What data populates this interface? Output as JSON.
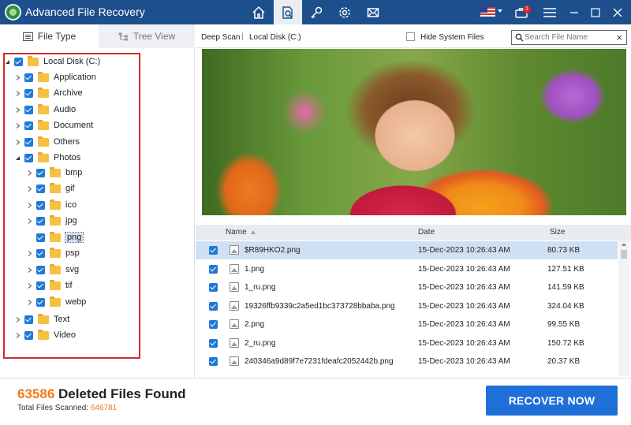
{
  "app": {
    "title": "Advanced File Recovery",
    "notification_count": "1"
  },
  "nav": [
    {
      "name": "home-icon"
    },
    {
      "name": "scan-icon",
      "active": true
    },
    {
      "name": "key-icon"
    },
    {
      "name": "gear-icon"
    },
    {
      "name": "mail-icon"
    }
  ],
  "left": {
    "tabs": {
      "file_type": "File Type",
      "tree_view": "Tree View"
    },
    "tree": {
      "root": "Local Disk (C:)",
      "items": [
        "Application",
        "Archive",
        "Audio",
        "Document",
        "Others",
        "Photos",
        "Text",
        "Video"
      ],
      "photos": [
        "bmp",
        "gif",
        "ico",
        "jpg",
        "png",
        "psp",
        "svg",
        "tif",
        "webp"
      ],
      "selected": "png"
    }
  },
  "topbar": {
    "scan_type": "Deep Scan",
    "separator": "|",
    "location": "Local Disk (C:)",
    "hide_system_files": "Hide System Files",
    "search_placeholder": "Search File Name"
  },
  "list": {
    "headers": {
      "name": "Name",
      "date": "Date",
      "size": "Size"
    },
    "rows": [
      {
        "name": "$R89HKO2.png",
        "date": "15-Dec-2023 10:26:43 AM",
        "size": "80.73 KB"
      },
      {
        "name": "1.png",
        "date": "15-Dec-2023 10:26:43 AM",
        "size": "127.51 KB"
      },
      {
        "name": "1_ru.png",
        "date": "15-Dec-2023 10:26:43 AM",
        "size": "141.59 KB"
      },
      {
        "name": "19326ffb9339c2a5ed1bc373728bbaba.png",
        "date": "15-Dec-2023 10:26:43 AM",
        "size": "324.04 KB"
      },
      {
        "name": "2.png",
        "date": "15-Dec-2023 10:26:43 AM",
        "size": "99.55 KB"
      },
      {
        "name": "2_ru.png",
        "date": "15-Dec-2023 10:26:43 AM",
        "size": "150.72 KB"
      },
      {
        "name": "240346a9d89f7e7231fdeafc2052442b.png",
        "date": "15-Dec-2023 10:26:43 AM",
        "size": "20.37 KB"
      }
    ]
  },
  "footer": {
    "deleted_count": "63586",
    "deleted_label": "Deleted Files Found",
    "scanned_label": "Total Files Scanned:",
    "scanned_count": "646781",
    "recover_label": "RECOVER NOW"
  },
  "colors": {
    "titlebar": "#1c4f8c",
    "accent": "#f07a1a",
    "button": "#1f6fd8",
    "selection": "#cfe0f5",
    "highlight_border": "#d42b2b"
  }
}
